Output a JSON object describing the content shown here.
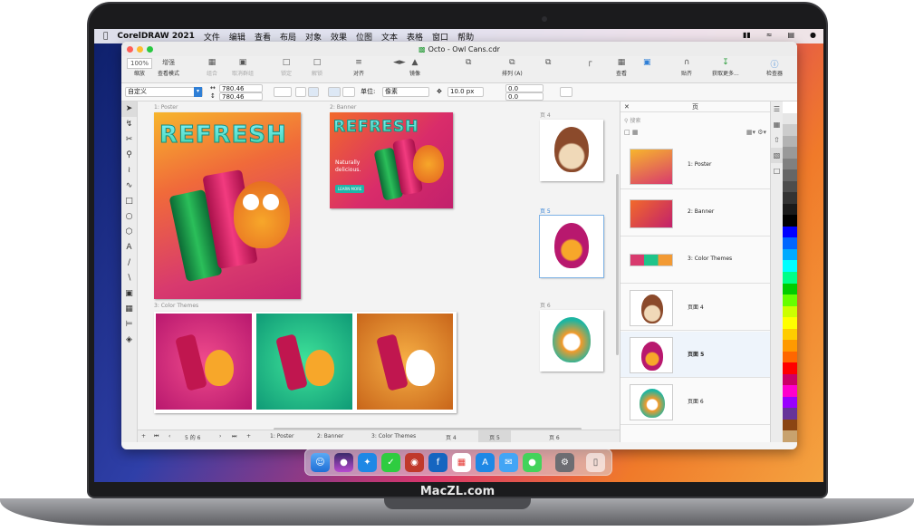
{
  "menubar": {
    "app": "CorelDRAW 2021",
    "items": [
      "文件",
      "编辑",
      "查看",
      "布局",
      "对象",
      "效果",
      "位图",
      "文本",
      "表格",
      "窗口",
      "帮助"
    ]
  },
  "window": {
    "title": "Octo - Owl Cans.cdr"
  },
  "toolbar": {
    "zoom": "100%",
    "zoom_label": "缩放",
    "view_mode": "增强",
    "view_mode_label": "查看模式",
    "combine": "组合",
    "ungroup": "取消群组",
    "lock": "锁定",
    "unlock": "解锁",
    "align": "对齐",
    "mirror": "镜像",
    "arrange": "排列 (A)",
    "view": "查看",
    "snap": "贴齐",
    "more": "获取更多...",
    "inspector": "检查器"
  },
  "propbar": {
    "preset": "自定义",
    "width": "780.46",
    "height": "780.46",
    "units_label": "单位:",
    "units": "像素",
    "nudge": "10.0 px",
    "dup_x": "0.0",
    "dup_y": "0.0"
  },
  "canvas": {
    "page1": "1: Poster",
    "page2": "2: Banner",
    "page3": "3: Color Themes",
    "page4": "页 4",
    "page5": "页 5",
    "page6": "页 6",
    "refresh": "REFRESH",
    "banner_text1": "Naturally",
    "banner_text2": "delicious.",
    "banner_btn": "LEARN MORE"
  },
  "bottombar": {
    "page_of": "5 的 6",
    "tabs": [
      "1: Poster",
      "2: Banner",
      "3: Color Themes",
      "页 4",
      "页 5",
      "页 6"
    ]
  },
  "panel": {
    "title": "页",
    "search_placeholder": "搜索",
    "pages": [
      "1: Poster",
      "2: Banner",
      "3: Color Themes",
      "页面 4",
      "页面 5",
      "页面 6"
    ]
  },
  "colors": {
    "accent": "#2f7fd6",
    "palette": [
      "#ffffff",
      "#e6e6e6",
      "#cccccc",
      "#b3b3b3",
      "#999999",
      "#808080",
      "#666666",
      "#4d4d4d",
      "#333333",
      "#1a1a1a",
      "#000000",
      "#0000ff",
      "#0066ff",
      "#00aaff",
      "#00ffff",
      "#00ff88",
      "#00cc00",
      "#66ff00",
      "#ccff00",
      "#ffff00",
      "#ffcc00",
      "#ff9900",
      "#ff6600",
      "#ff0000",
      "#cc0066",
      "#ff00cc",
      "#9900ff",
      "#663399",
      "#8b4513",
      "#c8a26e"
    ]
  },
  "branding": {
    "text": "MacZL.com"
  }
}
